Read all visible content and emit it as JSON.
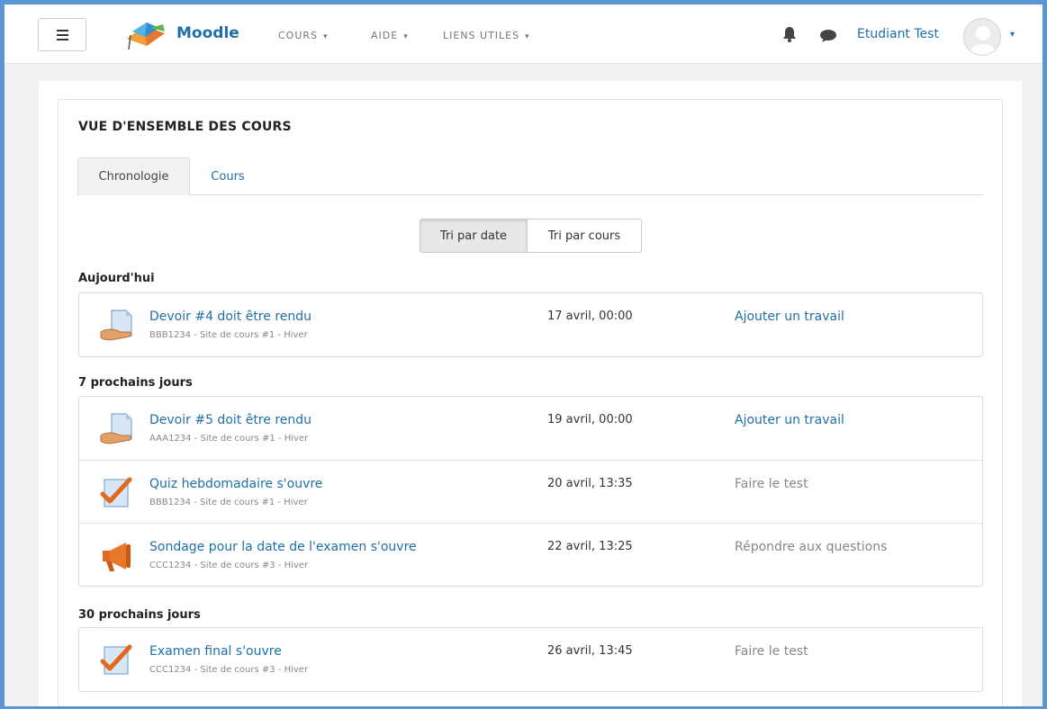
{
  "navbar": {
    "brand": "Moodle",
    "menu": [
      {
        "label": "COURS"
      },
      {
        "label": "AIDE"
      },
      {
        "label": "LIENS UTILES"
      }
    ],
    "username": "Etudiant Test"
  },
  "block": {
    "title": "VUE D'ENSEMBLE DES COURS",
    "tabs": [
      "Chronologie",
      "Cours"
    ],
    "sort": {
      "by_date": "Tri par date",
      "by_course": "Tri par cours"
    }
  },
  "sections": [
    {
      "label": "Aujourd'hui",
      "events": [
        {
          "icon": "assignment-icon",
          "name": "Devoir #4 doit être rendu",
          "course": "BBB1234 - Site de cours #1 - Hiver",
          "date": "17 avril, 00:00",
          "action": "Ajouter un travail",
          "action_active": true
        }
      ]
    },
    {
      "label": "7 prochains jours",
      "events": [
        {
          "icon": "assignment-icon",
          "name": "Devoir #5 doit être rendu",
          "course": "AAA1234 - Site de cours #1 - Hiver",
          "date": "19 avril, 00:00",
          "action": "Ajouter un travail",
          "action_active": true
        },
        {
          "icon": "quiz-icon",
          "name": "Quiz hebdomadaire s'ouvre",
          "course": "BBB1234 - Site de cours #1 - Hiver",
          "date": "20 avril, 13:35",
          "action": "Faire le test",
          "action_active": false
        },
        {
          "icon": "feedback-megaphone-icon",
          "name": "Sondage pour la date de l'examen s'ouvre",
          "course": "CCC1234 - Site de cours #3 - Hiver",
          "date": "22 avril, 13:25",
          "action": "Répondre aux questions",
          "action_active": false
        }
      ]
    },
    {
      "label": "30 prochains jours",
      "events": [
        {
          "icon": "quiz-icon",
          "name": "Examen final s'ouvre",
          "course": "CCC1234 - Site de cours #3 - Hiver",
          "date": "26 avril, 13:45",
          "action": "Faire le test",
          "action_active": false
        }
      ]
    }
  ],
  "colors": {
    "link": "#1f6fa8",
    "frame": "#5b95d6",
    "muted": "#888888"
  }
}
